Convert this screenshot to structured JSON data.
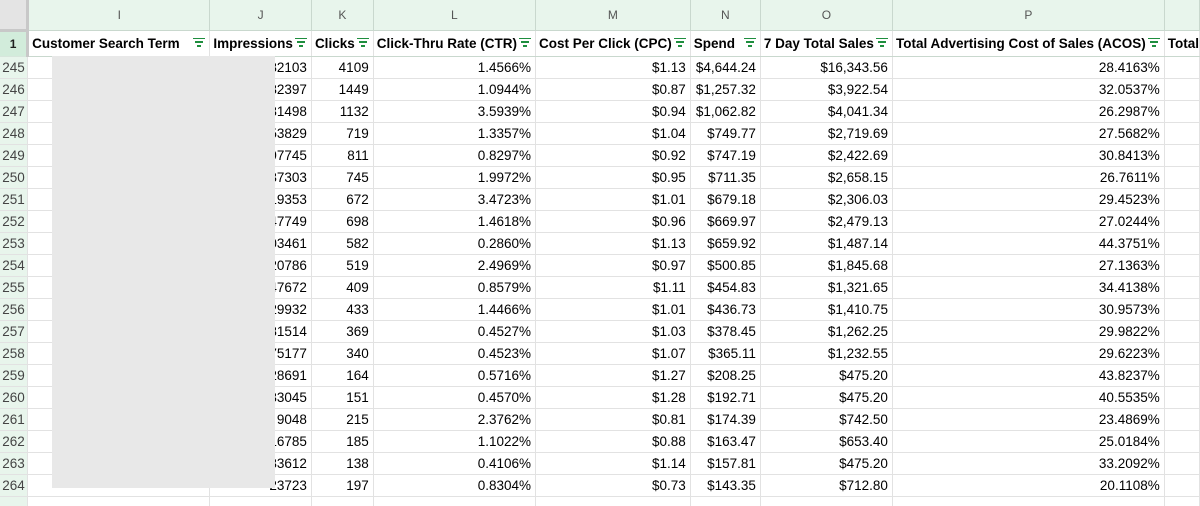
{
  "columns": [
    "I",
    "J",
    "K",
    "L",
    "M",
    "N",
    "O",
    "P",
    ""
  ],
  "header_row_number": "1",
  "headers": [
    "Customer Search Term",
    "Impressions",
    "Clicks",
    "Click-Thru Rate (CTR)",
    "Cost Per Click (CPC)",
    "Spend",
    "7 Day Total Sales",
    "Total Advertising Cost of Sales (ACOS)",
    "Total"
  ],
  "rows": [
    {
      "row": "245",
      "term": "",
      "impressions": "282103",
      "clicks": "4109",
      "ctr": "1.4566%",
      "cpc": "$1.13",
      "spend": "$4,644.24",
      "sales": "$16,343.56",
      "acos": "28.4163%"
    },
    {
      "row": "246",
      "term": "",
      "impressions": "132397",
      "clicks": "1449",
      "ctr": "1.0944%",
      "cpc": "$0.87",
      "spend": "$1,257.32",
      "sales": "$3,922.54",
      "acos": "32.0537%"
    },
    {
      "row": "247",
      "term": "",
      "impressions": "31498",
      "clicks": "1132",
      "ctr": "3.5939%",
      "cpc": "$0.94",
      "spend": "$1,062.82",
      "sales": "$4,041.34",
      "acos": "26.2987%"
    },
    {
      "row": "248",
      "term": "",
      "impressions": "53829",
      "clicks": "719",
      "ctr": "1.3357%",
      "cpc": "$1.04",
      "spend": "$749.77",
      "sales": "$2,719.69",
      "acos": "27.5682%"
    },
    {
      "row": "249",
      "term": "",
      "impressions": "97745",
      "clicks": "811",
      "ctr": "0.8297%",
      "cpc": "$0.92",
      "spend": "$747.19",
      "sales": "$2,422.69",
      "acos": "30.8413%"
    },
    {
      "row": "250",
      "term": "",
      "impressions": "37303",
      "clicks": "745",
      "ctr": "1.9972%",
      "cpc": "$0.95",
      "spend": "$711.35",
      "sales": "$2,658.15",
      "acos": "26.7611%"
    },
    {
      "row": "251",
      "term": "",
      "impressions": "19353",
      "clicks": "672",
      "ctr": "3.4723%",
      "cpc": "$1.01",
      "spend": "$679.18",
      "sales": "$2,306.03",
      "acos": "29.4523%"
    },
    {
      "row": "252",
      "term": "",
      "impressions": "47749",
      "clicks": "698",
      "ctr": "1.4618%",
      "cpc": "$0.96",
      "spend": "$669.97",
      "sales": "$2,479.13",
      "acos": "27.0244%"
    },
    {
      "row": "253",
      "term": "",
      "impressions": "203461",
      "clicks": "582",
      "ctr": "0.2860%",
      "cpc": "$1.13",
      "spend": "$659.92",
      "sales": "$1,487.14",
      "acos": "44.3751%"
    },
    {
      "row": "254",
      "term": "",
      "impressions": "20786",
      "clicks": "519",
      "ctr": "2.4969%",
      "cpc": "$0.97",
      "spend": "$500.85",
      "sales": "$1,845.68",
      "acos": "27.1363%"
    },
    {
      "row": "255",
      "term": "",
      "impressions": "47672",
      "clicks": "409",
      "ctr": "0.8579%",
      "cpc": "$1.11",
      "spend": "$454.83",
      "sales": "$1,321.65",
      "acos": "34.4138%"
    },
    {
      "row": "256",
      "term": "",
      "impressions": "29932",
      "clicks": "433",
      "ctr": "1.4466%",
      "cpc": "$1.01",
      "spend": "$436.73",
      "sales": "$1,410.75",
      "acos": "30.9573%"
    },
    {
      "row": "257",
      "term": "",
      "impressions": "81514",
      "clicks": "369",
      "ctr": "0.4527%",
      "cpc": "$1.03",
      "spend": "$378.45",
      "sales": "$1,262.25",
      "acos": "29.9822%"
    },
    {
      "row": "258",
      "term": "",
      "impressions": "75177",
      "clicks": "340",
      "ctr": "0.4523%",
      "cpc": "$1.07",
      "spend": "$365.11",
      "sales": "$1,232.55",
      "acos": "29.6223%"
    },
    {
      "row": "259",
      "term": "",
      "impressions": "28691",
      "clicks": "164",
      "ctr": "0.5716%",
      "cpc": "$1.27",
      "spend": "$208.25",
      "sales": "$475.20",
      "acos": "43.8237%"
    },
    {
      "row": "260",
      "term": "",
      "impressions": "33045",
      "clicks": "151",
      "ctr": "0.4570%",
      "cpc": "$1.28",
      "spend": "$192.71",
      "sales": "$475.20",
      "acos": "40.5535%"
    },
    {
      "row": "261",
      "term": "",
      "impressions": "9048",
      "clicks": "215",
      "ctr": "2.3762%",
      "cpc": "$0.81",
      "spend": "$174.39",
      "sales": "$742.50",
      "acos": "23.4869%"
    },
    {
      "row": "262",
      "term": "",
      "impressions": "16785",
      "clicks": "185",
      "ctr": "1.1022%",
      "cpc": "$0.88",
      "spend": "$163.47",
      "sales": "$653.40",
      "acos": "25.0184%"
    },
    {
      "row": "263",
      "term": "",
      "impressions": "33612",
      "clicks": "138",
      "ctr": "0.4106%",
      "cpc": "$1.14",
      "spend": "$157.81",
      "sales": "$475.20",
      "acos": "33.2092%"
    },
    {
      "row": "264",
      "term": "",
      "impressions": "23723",
      "clicks": "197",
      "ctr": "0.8304%",
      "cpc": "$0.73",
      "spend": "$143.35",
      "sales": "$712.80",
      "acos": "20.1108%"
    }
  ],
  "colors": {
    "header_band": "#e8f5ec",
    "filter_icon": "#1e8e3e",
    "redaction": "#e8e8e8"
  },
  "icons": {
    "filter": "filter-icon"
  }
}
